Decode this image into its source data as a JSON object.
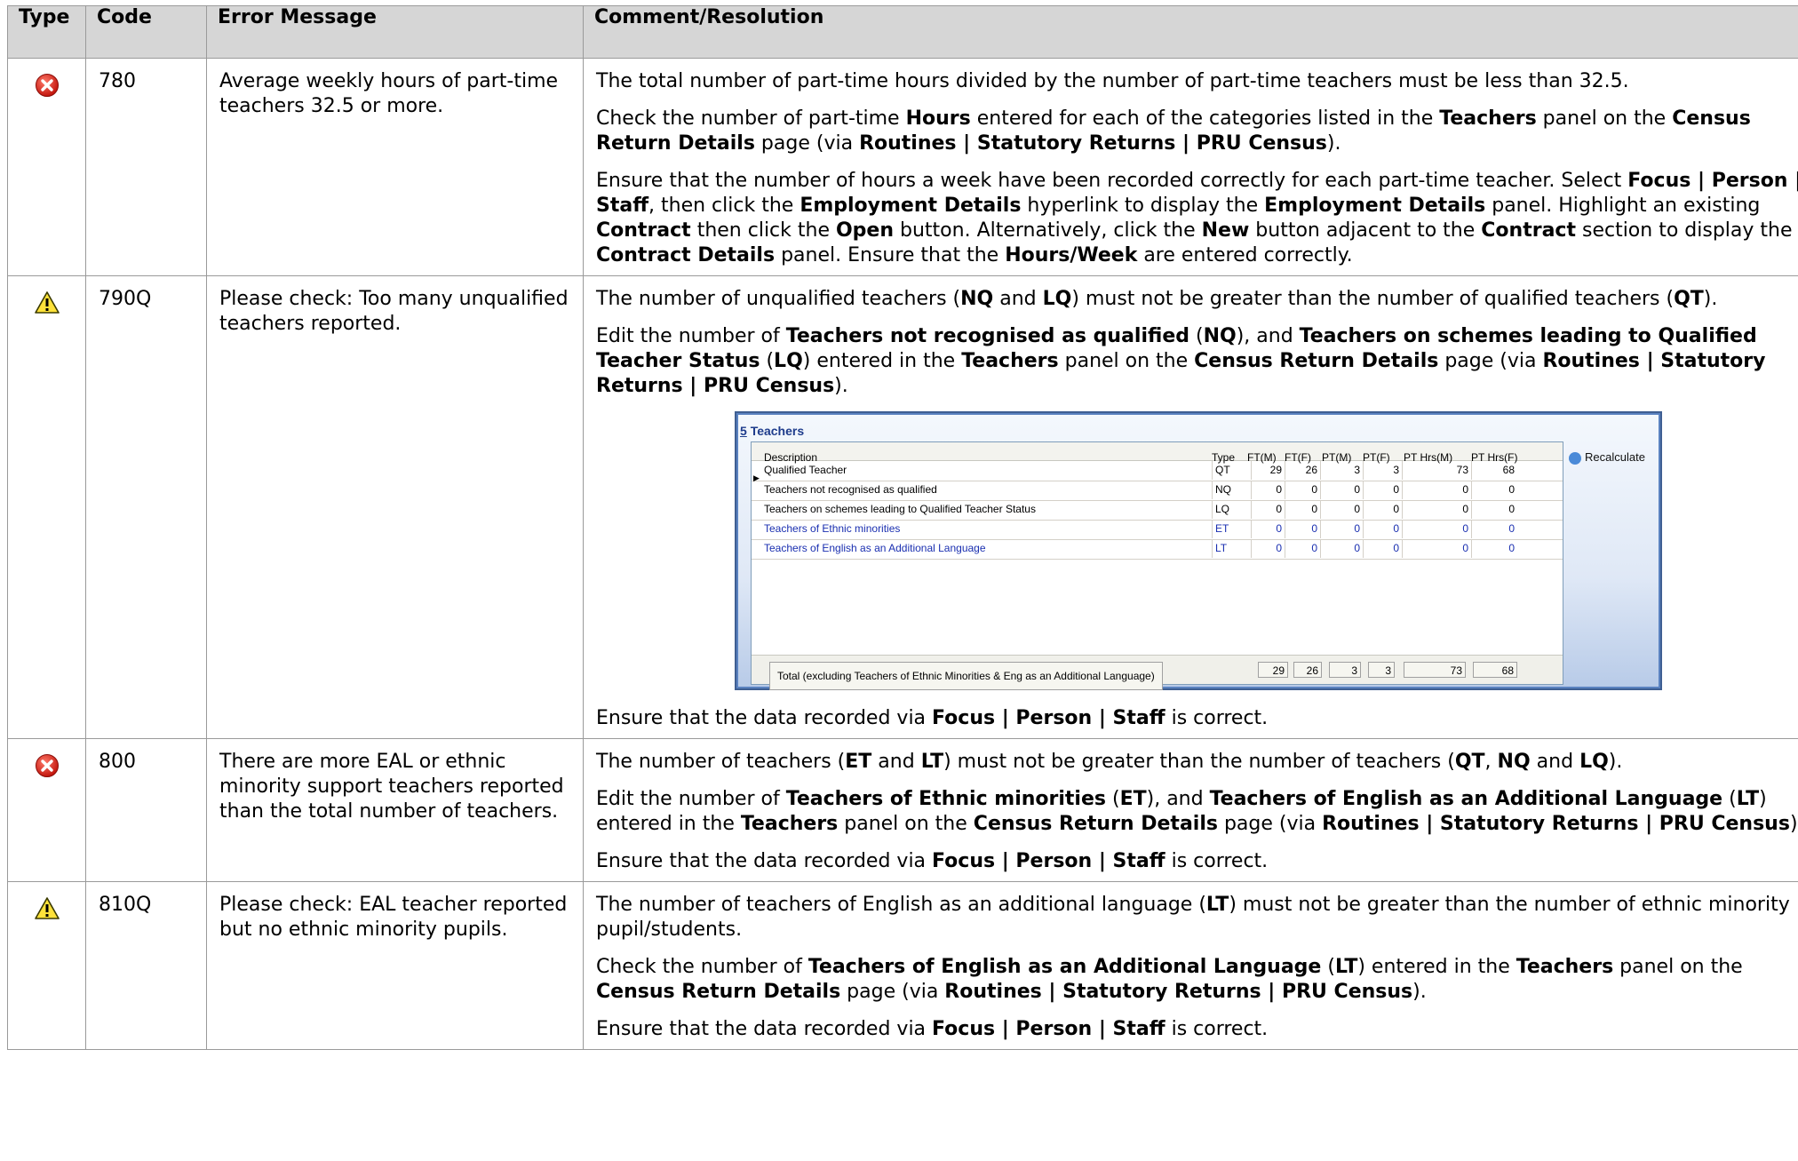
{
  "headers": {
    "type": "Type",
    "code": "Code",
    "error": "Error Message",
    "comment": "Comment/Resolution"
  },
  "rows": [
    {
      "icon": "error-icon",
      "code": "780",
      "message": "Average weekly hours of part-time teachers 32.5 or more.",
      "paragraphs": [
        "The total number of part-time hours divided by the number of part-time teachers must be less than 32.5.",
        "Check the number of part-time <b>Hours</b> entered for each of the categories listed in the <b>Teachers</b> panel on the <b>Census Return Details</b> page (via <b>Routines | Statutory Returns | PRU Census</b>).",
        "Ensure that the number of hours a week have been recorded correctly for each part-time teacher. Select <b>Focus | Person | Staff</b>, then click the <b>Employment Details</b> hyperlink to display the <b>Employment Details</b> panel. Highlight an existing <b>Contract</b> then click the <b>Open</b> button. Alternatively, click the <b>New</b> button adjacent to the <b>Contract</b> section to display the <b>Contract Details</b> panel. Ensure that the <b>Hours/Week</b> are entered correctly."
      ]
    },
    {
      "icon": "warning-icon",
      "code": "790Q",
      "message": "Please check: Too many unqualified teachers reported.",
      "paragraphs": [
        "The number of unqualified teachers (<b>NQ</b> and <b>LQ</b>) must not be greater than the number of qualified teachers (<b>QT</b>).",
        "Edit the number of <b>Teachers not recognised as qualified</b> (<b>NQ</b>), and <b>Teachers on schemes leading to Qualified Teacher Status</b> (<b>LQ</b>) entered in the <b>Teachers</b> panel on the <b>Census Return Details</b> page (via <b>Routines | Statutory Returns | PRU Census</b>)."
      ],
      "after": "Ensure that the data recorded via <b>Focus | Person | Staff</b> is correct."
    },
    {
      "icon": "error-icon",
      "code": "800",
      "message": "There are more EAL or ethnic minority support teachers reported than the total number of teachers.",
      "paragraphs": [
        "The number of teachers (<b>ET</b> and <b>LT</b>) must not be greater than the number of teachers (<b>QT</b>, <b>NQ</b> and <b>LQ</b>).",
        "Edit the number of <b>Teachers of Ethnic minorities</b> (<b>ET</b>), and <b>Teachers of English as an Additional Language</b> (<b>LT</b>) entered in the <b>Teachers</b> panel on the <b>Census Return Details</b> page (via <b>Routines | Statutory Returns | PRU Census</b>).",
        "Ensure that the data recorded via <b>Focus | Person | Staff</b> is correct."
      ]
    },
    {
      "icon": "warning-icon",
      "code": "810Q",
      "message": "Please check: EAL teacher reported but no ethnic minority pupils.",
      "paragraphs": [
        "The number of teachers of English as an additional language (<b>LT</b>) must not be greater than the number of ethnic minority pupil/students.",
        "Check the number of <b>Teachers of English as an Additional Language</b> (<b>LT</b>) entered in the <b>Teachers</b> panel on the <b>Census Return Details</b> page (via <b>Routines | Statutory Returns | PRU Census</b>).",
        "Ensure that the data recorded via <b>Focus | Person | Staff</b> is correct."
      ]
    }
  ],
  "panel": {
    "title_num": "5",
    "title": "Teachers",
    "recalc": "Recalculate",
    "cols": [
      "Description",
      "Type",
      "FT(M)",
      "FT(F)",
      "PT(M)",
      "PT(F)",
      "PT Hrs(M)",
      "PT Hrs(F)"
    ],
    "rows": [
      {
        "d": "Qualified Teacher",
        "t": "QT",
        "v": [
          "29",
          "26",
          "3",
          "3",
          "73",
          "68"
        ],
        "blue": false
      },
      {
        "d": "Teachers not recognised as qualified",
        "t": "NQ",
        "v": [
          "0",
          "0",
          "0",
          "0",
          "0",
          "0"
        ],
        "blue": false
      },
      {
        "d": "Teachers on schemes leading to Qualified Teacher Status",
        "t": "LQ",
        "v": [
          "0",
          "0",
          "0",
          "0",
          "0",
          "0"
        ],
        "blue": false
      },
      {
        "d": "Teachers of Ethnic minorities",
        "t": "ET",
        "v": [
          "0",
          "0",
          "0",
          "0",
          "0",
          "0"
        ],
        "blue": true
      },
      {
        "d": "Teachers of English as an Additional Language",
        "t": "LT",
        "v": [
          "0",
          "0",
          "0",
          "0",
          "0",
          "0"
        ],
        "blue": true
      }
    ],
    "total_label": "Total (excluding Teachers of Ethnic Minorities & Eng as an Additional Language)",
    "totals": [
      "29",
      "26",
      "3",
      "3",
      "73",
      "68"
    ]
  }
}
